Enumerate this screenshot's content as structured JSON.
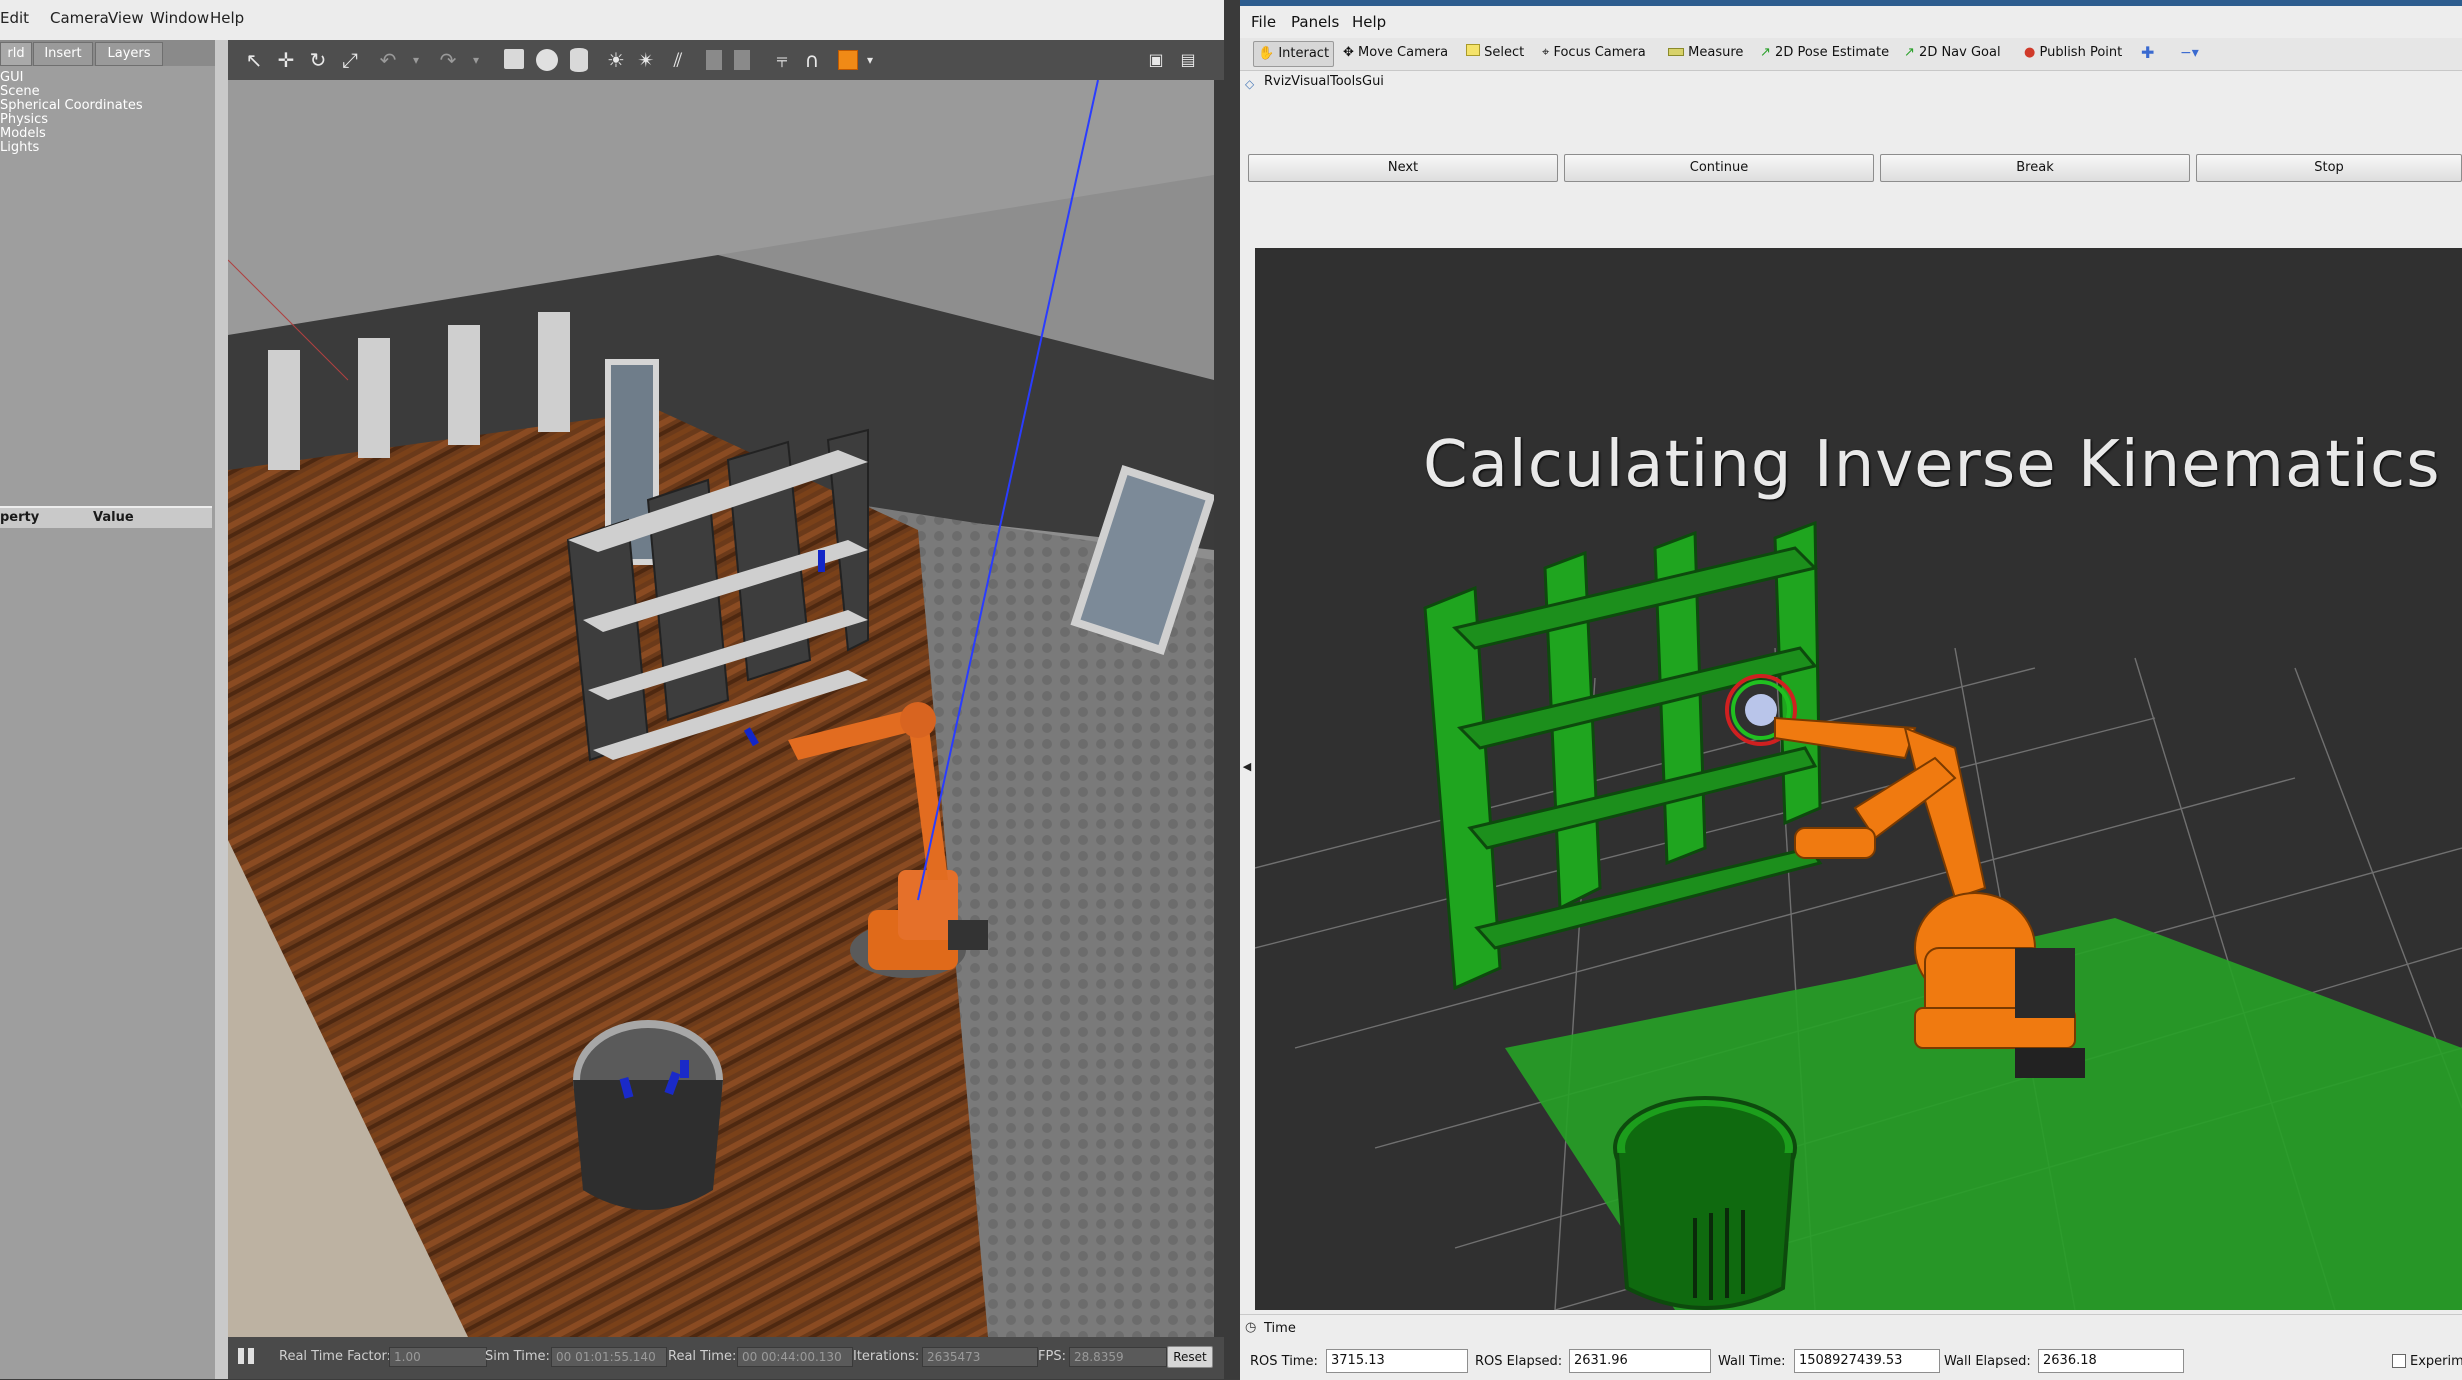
{
  "gazebo": {
    "menu": [
      "Edit",
      "Camera",
      "View",
      "Window",
      "Help"
    ],
    "left_tabs": [
      "rld",
      "Insert",
      "Layers"
    ],
    "tree": [
      "GUI",
      "Scene",
      "Spherical Coordinates",
      "Physics",
      "Models",
      "Lights"
    ],
    "property_headers": {
      "property": "perty",
      "value": "Value"
    },
    "toolbar_icons": [
      "select-arrow-icon",
      "translate-icon",
      "rotate-icon",
      "scale-icon",
      "undo-icon",
      "redo-icon",
      "box-icon",
      "sphere-icon",
      "cylinder-icon",
      "point-light-icon",
      "spot-light-icon",
      "directional-light-icon",
      "copy-icon",
      "paste-icon",
      "align-icon",
      "snap-icon",
      "color-icon",
      "screenshot-icon",
      "log-icon"
    ],
    "status": {
      "real_time_factor_label": "Real Time Factor:",
      "real_time_factor": "1.00",
      "sim_time_label": "Sim Time:",
      "sim_time": "00 01:01:55.140",
      "real_time_label": "Real Time:",
      "real_time": "00 00:44:00.130",
      "iterations_label": "Iterations:",
      "iterations": "2635473",
      "fps_label": "FPS:",
      "fps": "28.8359",
      "reset_label": "Reset"
    }
  },
  "rviz": {
    "menu": [
      "File",
      "Panels",
      "Help"
    ],
    "tools": [
      "Interact",
      "Move Camera",
      "Select",
      "Focus Camera",
      "Measure",
      "2D Pose Estimate",
      "2D Nav Goal",
      "Publish Point"
    ],
    "panel_title": "RvizVisualToolsGui",
    "buttons": [
      "Next",
      "Continue",
      "Break",
      "Stop"
    ],
    "overlay_text": "Calculating  Inverse  Kinematics",
    "time_panel_title": "Time",
    "time": {
      "ros_time_label": "ROS Time:",
      "ros_time": "3715.13",
      "ros_elapsed_label": "ROS Elapsed:",
      "ros_elapsed": "2631.96",
      "wall_time_label": "Wall Time:",
      "wall_time": "1508927439.53",
      "wall_elapsed_label": "Wall Elapsed:",
      "wall_elapsed": "2636.18",
      "experimental_label": "Experim"
    },
    "colors": {
      "shelf_green": "#1ea11e",
      "robot_orange": "#f07a10",
      "grid_line": "#7a7a7a",
      "floor_green": "#27a027"
    }
  }
}
